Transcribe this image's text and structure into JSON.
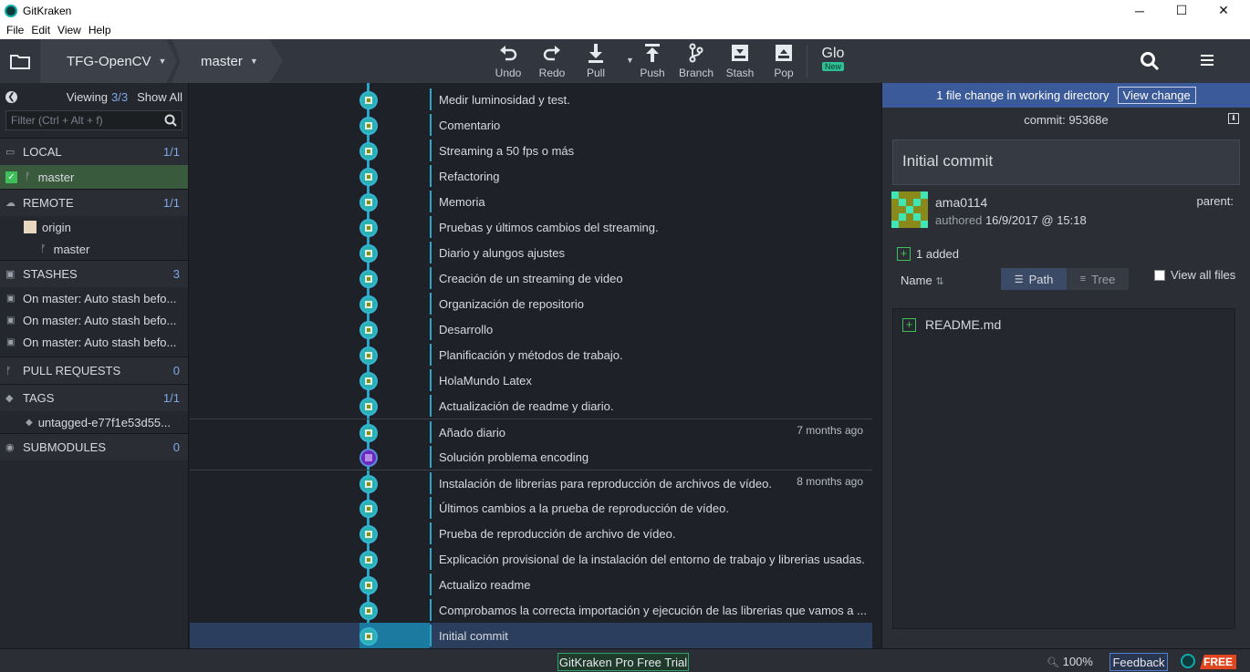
{
  "window": {
    "title": "GitKraken",
    "controls": [
      "─",
      "☐",
      "✕"
    ]
  },
  "menu": [
    "File",
    "Edit",
    "View",
    "Help"
  ],
  "toolbar": {
    "repo": "TFG-OpenCV",
    "branch": "master",
    "buttons": [
      {
        "label": "Undo",
        "icon": "undo-icon"
      },
      {
        "label": "Redo",
        "icon": "redo-icon"
      },
      {
        "label": "Pull",
        "icon": "pull-icon"
      },
      {
        "label": "Push",
        "icon": "push-icon"
      },
      {
        "label": "Branch",
        "icon": "branch-icon"
      },
      {
        "label": "Stash",
        "icon": "stash-icon"
      },
      {
        "label": "Pop",
        "icon": "pop-icon"
      }
    ],
    "glo": "Glo",
    "glo_badge": "New"
  },
  "left": {
    "viewing_label": "Viewing",
    "viewing_count": "3/3",
    "show_all": "Show All",
    "filter_placeholder": "Filter (Ctrl + Alt + f)",
    "local": {
      "title": "LOCAL",
      "count": "1/1",
      "branch": "master"
    },
    "remote": {
      "title": "REMOTE",
      "count": "1/1",
      "origin": "origin",
      "branch": "master"
    },
    "stashes": {
      "title": "STASHES",
      "count": "3",
      "items": [
        "On master: Auto stash befo...",
        "On master: Auto stash befo...",
        "On master: Auto stash befo..."
      ]
    },
    "pull_requests": {
      "title": "PULL REQUESTS",
      "count": "0"
    },
    "tags": {
      "title": "TAGS",
      "count": "1/1",
      "item": "untagged-e77f1e53d55..."
    },
    "submodules": {
      "title": "SUBMODULES",
      "count": "0"
    }
  },
  "commits": [
    {
      "msg": "Medir luminosidad y test.",
      "age": ""
    },
    {
      "msg": "Comentario",
      "age": ""
    },
    {
      "msg": "Streaming a 50 fps o más",
      "age": ""
    },
    {
      "msg": "Refactoring",
      "age": ""
    },
    {
      "msg": "Memoria",
      "age": ""
    },
    {
      "msg": "Pruebas y últimos cambios del streaming.",
      "age": ""
    },
    {
      "msg": "Diario y alungos ajustes",
      "age": ""
    },
    {
      "msg": "Creación de un streaming de video",
      "age": ""
    },
    {
      "msg": "Organización de repositorio",
      "age": ""
    },
    {
      "msg": "Desarrollo",
      "age": ""
    },
    {
      "msg": "Planificación y métodos de trabajo.",
      "age": ""
    },
    {
      "msg": "HolaMundo Latex",
      "age": ""
    },
    {
      "msg": "Actualización de readme y diario.",
      "age": ""
    },
    {
      "msg": "Añado diario",
      "age": "7 months ago"
    },
    {
      "msg": "Solución problema encoding",
      "age": ""
    },
    {
      "msg": "Instalación de librerias para reproducción de archivos de vídeo.",
      "age": "8 months ago"
    },
    {
      "msg": "Últimos cambios a la prueba de reproducción de vídeo.",
      "age": ""
    },
    {
      "msg": "Prueba de reproducción de archivo de vídeo.",
      "age": ""
    },
    {
      "msg": "Explicación provisional de la instalación del entorno de trabajo y librerias usadas.",
      "age": ""
    },
    {
      "msg": "Actualizo readme",
      "age": ""
    },
    {
      "msg": "Comprobamos la correcta importación y ejecución de las librerias que vamos a ...",
      "age": ""
    },
    {
      "msg": "Initial commit",
      "age": "",
      "selected": true
    }
  ],
  "right": {
    "wd_text": "1 file change in working directory",
    "view_change": "View change",
    "commit_label": "commit:",
    "commit_hash": "95368e",
    "summary": "Initial commit",
    "author": "ama0114",
    "authored_label": "authored",
    "authored_date": "16/9/2017 @ 15:18",
    "parent_label": "parent:",
    "added": "1 added",
    "sort_label": "Name",
    "path_tab": "Path",
    "tree_tab": "Tree",
    "view_all": "View all files",
    "files": [
      "README.md"
    ]
  },
  "status": {
    "trial": "GitKraken Pro Free Trial",
    "zoom": "100%",
    "feedback": "Feedback",
    "free": "FREE"
  }
}
